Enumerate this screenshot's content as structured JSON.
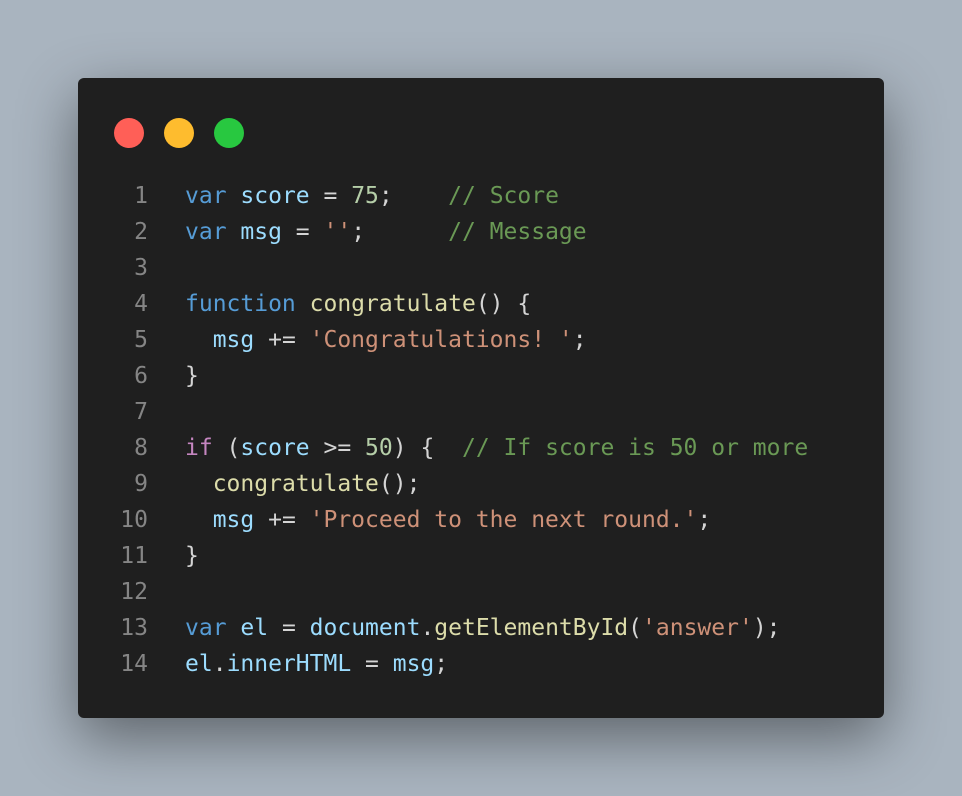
{
  "window": {
    "controls": {
      "close_color": "#ff5f57",
      "minimize_color": "#febc2e",
      "maximize_color": "#28c840"
    }
  },
  "editor": {
    "language": "javascript",
    "lines": [
      {
        "number": "1",
        "tokens": [
          {
            "t": "var",
            "c": "kw"
          },
          {
            "t": " ",
            "c": "pun"
          },
          {
            "t": "score",
            "c": "var"
          },
          {
            "t": " = ",
            "c": "pun"
          },
          {
            "t": "75",
            "c": "num"
          },
          {
            "t": ";    ",
            "c": "pun"
          },
          {
            "t": "// Score",
            "c": "com"
          }
        ]
      },
      {
        "number": "2",
        "tokens": [
          {
            "t": "var",
            "c": "kw"
          },
          {
            "t": " ",
            "c": "pun"
          },
          {
            "t": "msg",
            "c": "var"
          },
          {
            "t": " = ",
            "c": "pun"
          },
          {
            "t": "''",
            "c": "str"
          },
          {
            "t": ";      ",
            "c": "pun"
          },
          {
            "t": "// Message",
            "c": "com"
          }
        ]
      },
      {
        "number": "3",
        "tokens": []
      },
      {
        "number": "4",
        "tokens": [
          {
            "t": "function",
            "c": "kw"
          },
          {
            "t": " ",
            "c": "pun"
          },
          {
            "t": "congratulate",
            "c": "fn"
          },
          {
            "t": "() {",
            "c": "pun"
          }
        ]
      },
      {
        "number": "5",
        "tokens": [
          {
            "t": "  ",
            "c": "pun"
          },
          {
            "t": "msg",
            "c": "var"
          },
          {
            "t": " += ",
            "c": "pun"
          },
          {
            "t": "'Congratulations! '",
            "c": "str"
          },
          {
            "t": ";",
            "c": "pun"
          }
        ]
      },
      {
        "number": "6",
        "tokens": [
          {
            "t": "}",
            "c": "pun"
          }
        ]
      },
      {
        "number": "7",
        "tokens": []
      },
      {
        "number": "8",
        "tokens": [
          {
            "t": "if",
            "c": "ctl"
          },
          {
            "t": " (",
            "c": "pun"
          },
          {
            "t": "score",
            "c": "var"
          },
          {
            "t": " >= ",
            "c": "pun"
          },
          {
            "t": "50",
            "c": "num"
          },
          {
            "t": ") {  ",
            "c": "pun"
          },
          {
            "t": "// If score is 50 or more",
            "c": "com"
          }
        ]
      },
      {
        "number": "9",
        "tokens": [
          {
            "t": "  ",
            "c": "pun"
          },
          {
            "t": "congratulate",
            "c": "fn"
          },
          {
            "t": "();",
            "c": "pun"
          }
        ]
      },
      {
        "number": "10",
        "tokens": [
          {
            "t": "  ",
            "c": "pun"
          },
          {
            "t": "msg",
            "c": "var"
          },
          {
            "t": " += ",
            "c": "pun"
          },
          {
            "t": "'Proceed to the next round.'",
            "c": "str"
          },
          {
            "t": ";",
            "c": "pun"
          }
        ]
      },
      {
        "number": "11",
        "tokens": [
          {
            "t": "}",
            "c": "pun"
          }
        ]
      },
      {
        "number": "12",
        "tokens": []
      },
      {
        "number": "13",
        "tokens": [
          {
            "t": "var",
            "c": "kw"
          },
          {
            "t": " ",
            "c": "pun"
          },
          {
            "t": "el",
            "c": "var"
          },
          {
            "t": " = ",
            "c": "pun"
          },
          {
            "t": "document",
            "c": "var"
          },
          {
            "t": ".",
            "c": "pun"
          },
          {
            "t": "getElementById",
            "c": "fn"
          },
          {
            "t": "(",
            "c": "pun"
          },
          {
            "t": "'answer'",
            "c": "str"
          },
          {
            "t": ");",
            "c": "pun"
          }
        ]
      },
      {
        "number": "14",
        "tokens": [
          {
            "t": "el",
            "c": "var"
          },
          {
            "t": ".",
            "c": "pun"
          },
          {
            "t": "innerHTML",
            "c": "var"
          },
          {
            "t": " = ",
            "c": "pun"
          },
          {
            "t": "msg",
            "c": "var"
          },
          {
            "t": ";",
            "c": "pun"
          }
        ]
      }
    ]
  }
}
